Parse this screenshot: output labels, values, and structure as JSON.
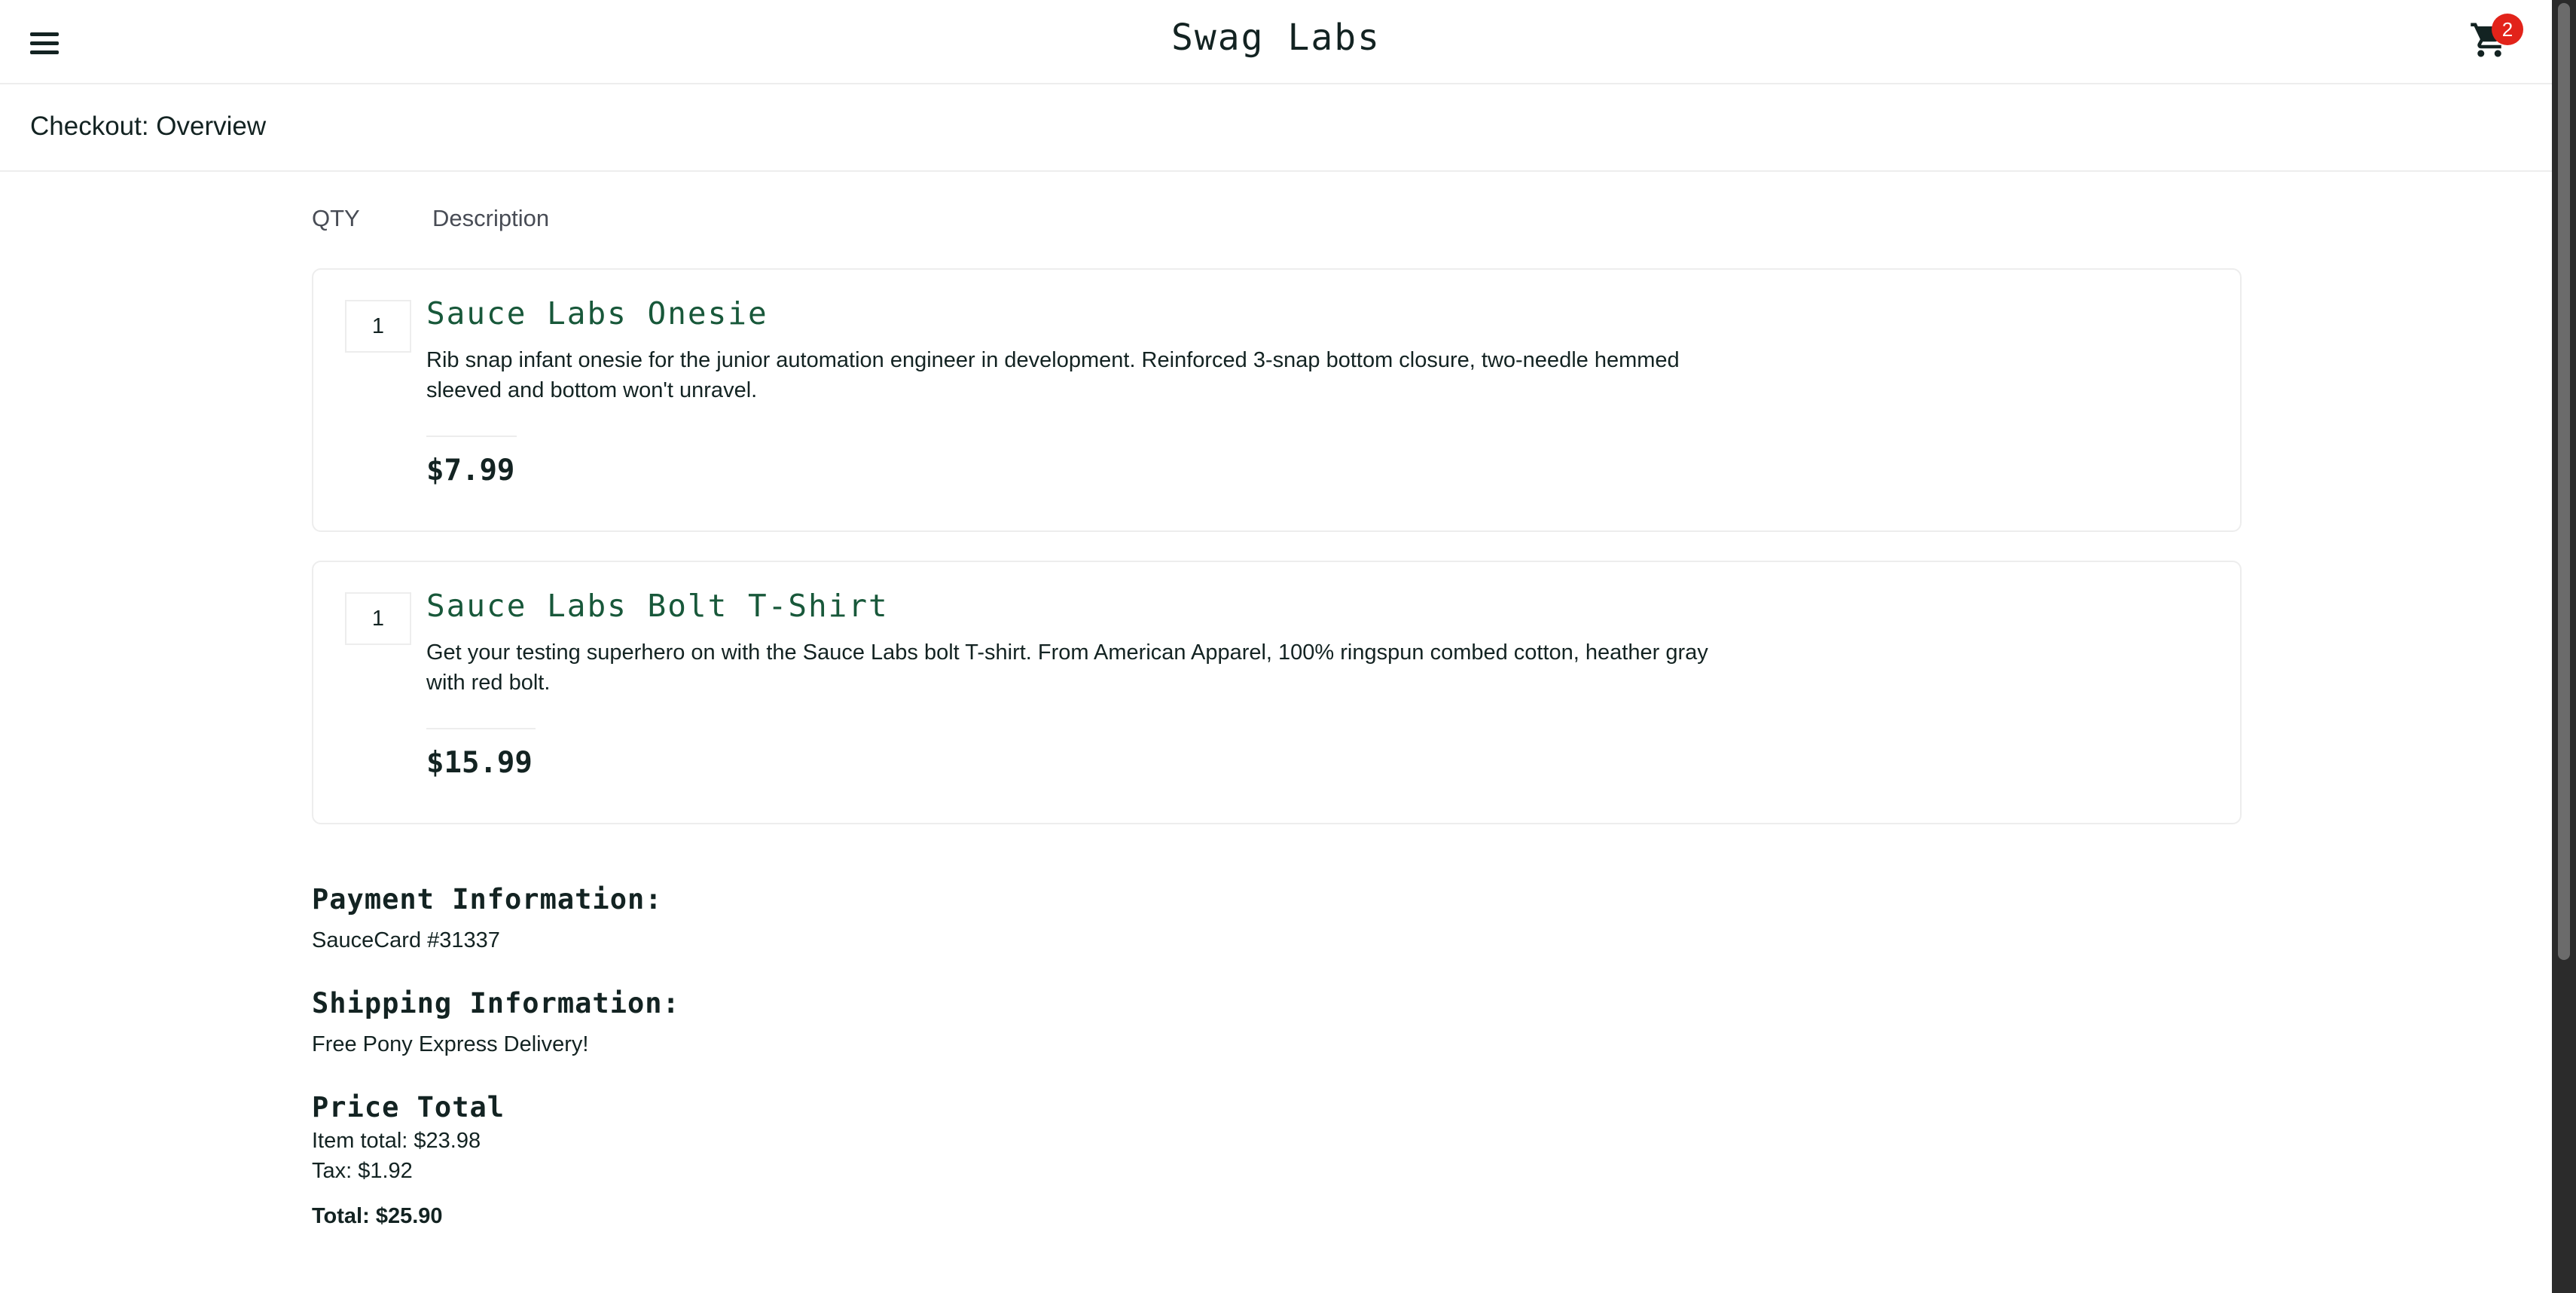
{
  "header": {
    "app_title": "Swag Labs",
    "menu_icon": "hamburger-menu-icon",
    "cart_icon": "shopping-cart-icon",
    "cart_badge": "2",
    "badge_color": "#e2231a"
  },
  "secondary_header": {
    "title": "Checkout: Overview"
  },
  "columns": {
    "qty": "QTY",
    "description": "Description"
  },
  "items": [
    {
      "qty": "1",
      "name": "Sauce Labs Onesie",
      "description": "Rib snap infant onesie for the junior automation engineer in development. Reinforced 3-snap bottom closure, two-needle hemmed sleeved and bottom won't unravel.",
      "price": "$7.99"
    },
    {
      "qty": "1",
      "name": "Sauce Labs Bolt T-Shirt",
      "description": "Get your testing superhero on with the Sauce Labs bolt T-shirt. From American Apparel, 100% ringspun combed cotton, heather gray with red bolt.",
      "price": "$15.99"
    }
  ],
  "summary": {
    "payment_label": "Payment Information:",
    "payment_value": "SauceCard #31337",
    "shipping_label": "Shipping Information:",
    "shipping_value": "Free Pony Express Delivery!",
    "price_label": "Price Total",
    "item_total": "Item total: $23.98",
    "tax": "Tax: $1.92",
    "total": "Total: $25.90"
  },
  "colors": {
    "item_name": "#18583a",
    "text": "#132322",
    "border": "#ededed"
  }
}
